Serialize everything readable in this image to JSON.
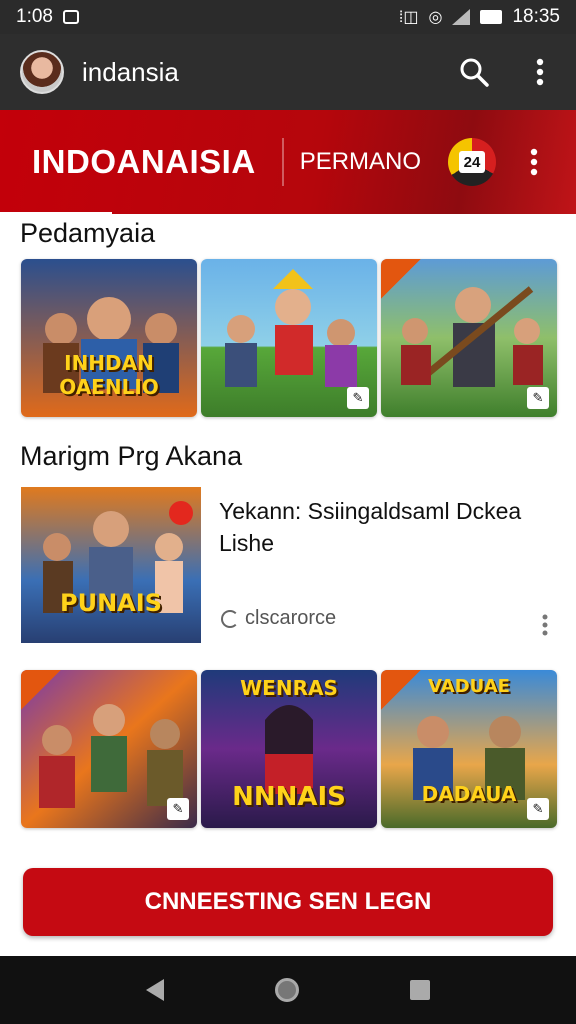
{
  "status_bar": {
    "time_left": "1:08",
    "time_right": "18:35"
  },
  "app_bar": {
    "title": "indansia",
    "search_icon": "search-icon",
    "more_icon": "more-vert-icon"
  },
  "banner": {
    "title": "INDOANAISIA",
    "subtitle": "PERMANO",
    "badge_text": "24",
    "colors": {
      "primary": "#c3000a",
      "dark": "#8e0b10"
    }
  },
  "sections": {
    "first": {
      "title": "Pedamyaia"
    },
    "second": {
      "title": "Marigm Prg Akana"
    }
  },
  "row1": [
    {
      "caption": "INHDAN OAENLIO",
      "badge": ""
    },
    {
      "caption": "",
      "badge": "✎"
    },
    {
      "caption": "",
      "badge": "✎"
    }
  ],
  "feature": {
    "image_caption": "PUNAIS",
    "title": "Yekann: Ssiingaldsaml Dckea Lishe",
    "meta_text": "clscarorce"
  },
  "row2": [
    {
      "caption": "",
      "badge": "✎"
    },
    {
      "caption": "NNNAIS",
      "top_caption": "WENRAS",
      "badge": ""
    },
    {
      "caption": "DADAUA",
      "top_caption": "VADUAE",
      "badge": "✎"
    }
  ],
  "cta": {
    "label": "CNNEESTING SEN LEGN"
  }
}
